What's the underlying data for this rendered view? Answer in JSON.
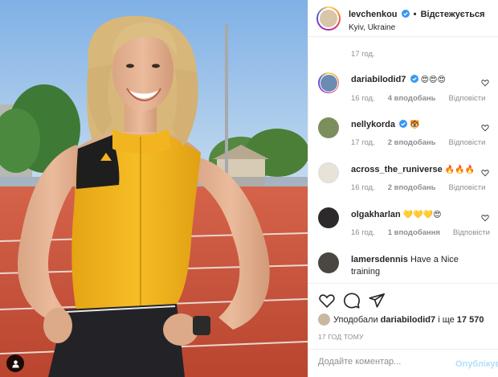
{
  "post": {
    "author": "levchenkou",
    "follow_label": "Відстежується",
    "location": "Kyiv, Ukraine",
    "caption_time": "17 год."
  },
  "comments": [
    {
      "user": "dariabilodid7",
      "verified": true,
      "text": "😍😍😍",
      "time": "16 год.",
      "likes": "4 вподобань",
      "reply": "Відповісти",
      "avatar_color": "#6b8bb3"
    },
    {
      "user": "nellykorda",
      "verified": true,
      "text": "🐯",
      "time": "17 год.",
      "likes": "2 вподобань",
      "reply": "Відповісти",
      "avatar_color": "#7a8f5c"
    },
    {
      "user": "across_the_runiverse",
      "verified": false,
      "text": "🔥🔥🔥",
      "time": "16 год.",
      "likes": "2 вподобань",
      "reply": "Відповісти",
      "avatar_color": "#e8e3d8"
    },
    {
      "user": "olgakharlan",
      "verified": false,
      "text": "💛💛💛😍",
      "time": "16 год.",
      "likes": "1 вподобання",
      "reply": "Відповісти",
      "avatar_color": "#2c2a2a"
    },
    {
      "user": "lamersdennis",
      "verified": false,
      "text": "Have a Nice training",
      "avatar_color": "#4a4640"
    }
  ],
  "likes": {
    "prefix": "Уподобали",
    "user": "dariabilodid7",
    "and": "і ще",
    "count": "17 570"
  },
  "post_time": "17 ГОД ТОМУ",
  "add_comment": {
    "placeholder": "Додайте коментар...",
    "post_label": "Опублікувати"
  },
  "icons": {
    "like": "heart-icon",
    "comment": "comment-icon",
    "share": "paper-plane-icon",
    "verified": "verified-badge-icon",
    "tag": "user-tag-icon"
  },
  "colors": {
    "verified": "#3897f0",
    "secondary_text": "#8e8e8e",
    "post_disabled": "#b2dffc",
    "top_yellow": "#f0b21c",
    "track_red": "#c9523a"
  }
}
